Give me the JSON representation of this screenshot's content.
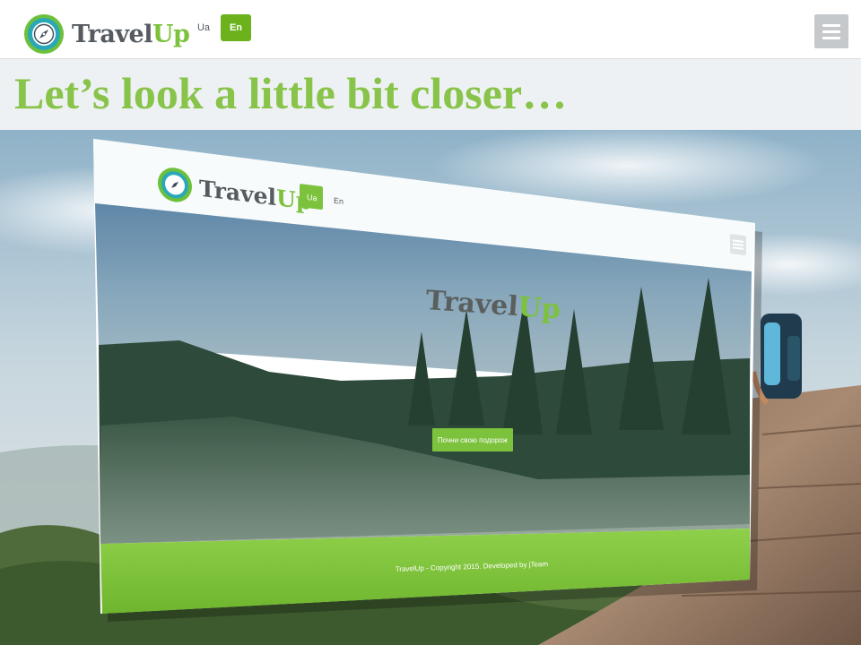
{
  "header": {
    "logo": {
      "word_1": "Travel",
      "word_2": "Up",
      "icon": "compass-icon"
    },
    "languages": [
      {
        "label": "Ua",
        "active": false
      },
      {
        "label": "En",
        "active": true
      }
    ],
    "menu_icon": "hamburger-icon"
  },
  "headline": "Let’s look a little bit closer…",
  "mockup": {
    "logo": {
      "word_1": "Travel",
      "word_2": "Up"
    },
    "languages": [
      {
        "label": "Ua",
        "active": true
      },
      {
        "label": "En",
        "active": false
      }
    ],
    "hero_title": {
      "word_1": "Travel",
      "word_2": "Up"
    },
    "cta_label": "Почни свою подорож",
    "footer_text": "TravelUp - Copyright 2015. Developed by jTeam"
  },
  "colors": {
    "brand_green": "#7cc23d",
    "button_green": "#6bb21d",
    "headline_green": "#88c34a",
    "logo_gray": "#555b60"
  }
}
